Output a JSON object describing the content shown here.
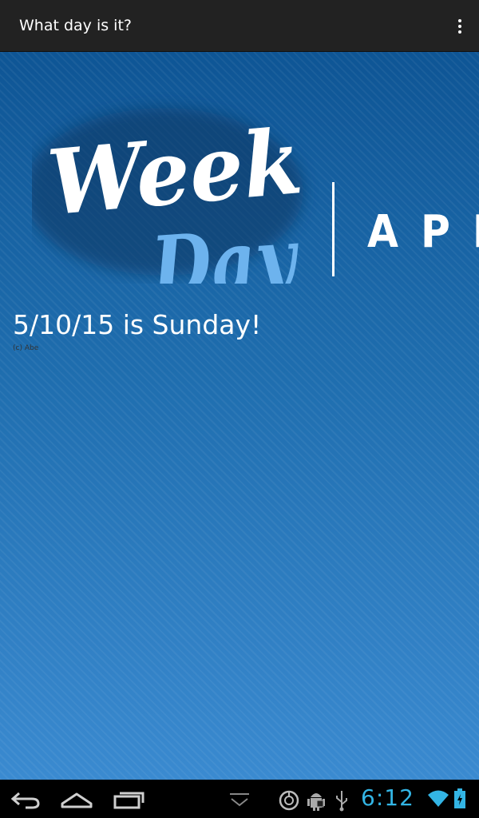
{
  "app_bar": {
    "title": "What day is it?",
    "overflow_icon": "more-vert-icon"
  },
  "logo": {
    "word1": "Week",
    "word2": "Day",
    "suffix": "APP",
    "colors": {
      "word1": "#ffffff",
      "word2": "#6db3ee",
      "suffix": "#ffffff"
    }
  },
  "main": {
    "result": "5/10/15 is Sunday!",
    "copyright": "(c) Abe"
  },
  "system_bar": {
    "clock": "6:12",
    "clock_color": "#33b5e5",
    "nav_icons": [
      "back-icon",
      "home-icon",
      "recent-apps-icon",
      "collapse-icon"
    ],
    "status_icons": [
      "sync-icon",
      "android-debug-icon",
      "usb-icon",
      "wifi-icon",
      "battery-icon"
    ]
  },
  "colors": {
    "app_bar_bg": "#222222",
    "content_bg_top": "#0e5595",
    "content_bg_bottom": "#3a8ad0"
  }
}
